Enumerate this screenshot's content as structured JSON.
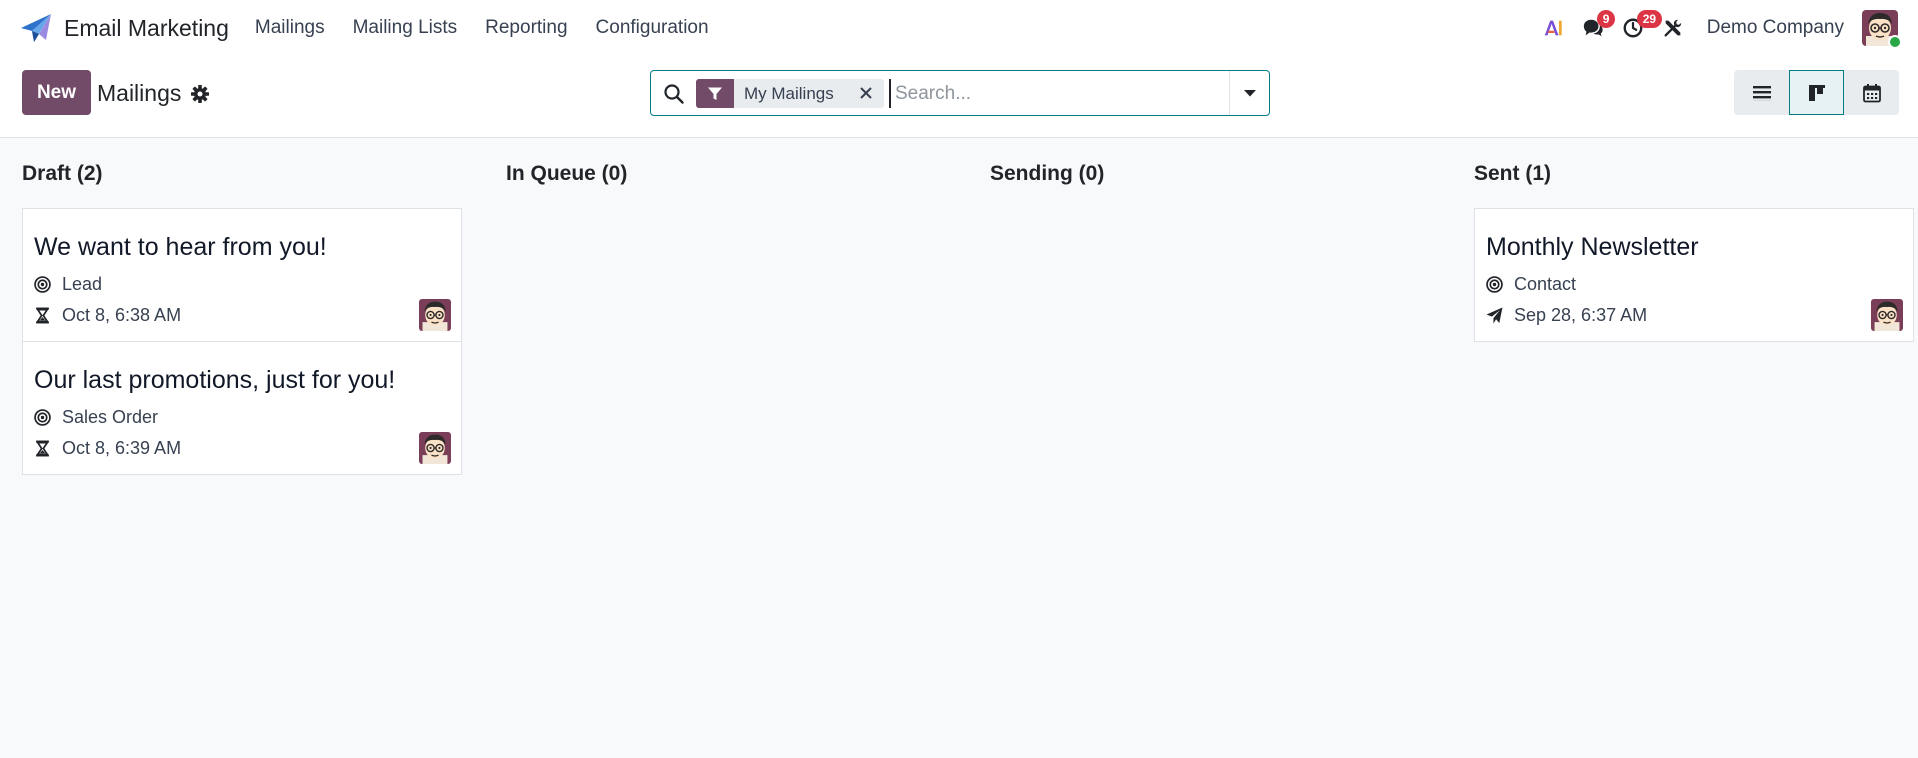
{
  "app": {
    "name": "Email Marketing",
    "brand_icon": "paper-plane-logo"
  },
  "menu": [
    {
      "label": "Mailings"
    },
    {
      "label": "Mailing Lists"
    },
    {
      "label": "Reporting"
    },
    {
      "label": "Configuration"
    }
  ],
  "systray": {
    "ai_icon": "ai-icon",
    "messages": {
      "icon": "chat-icon",
      "count": "9"
    },
    "activities": {
      "icon": "clock-icon",
      "count": "29"
    },
    "debug_icon": "tools-icon",
    "company": "Demo Company",
    "user_status": "online"
  },
  "control_panel": {
    "new_label": "New",
    "title": "Mailings",
    "search": {
      "facet_label": "My Mailings",
      "placeholder": "Search..."
    },
    "views": [
      "list",
      "kanban",
      "calendar"
    ],
    "active_view": "kanban"
  },
  "colors": {
    "primary": "#714b67",
    "accent": "#017e84",
    "badge": "#dc3545"
  },
  "columns": [
    {
      "title": "Draft (2)",
      "cards": [
        {
          "title": "We want to hear from you!",
          "target": "Lead",
          "date_icon": "hourglass-icon",
          "date": "Oct 8, 6:38 AM"
        },
        {
          "title": "Our last promotions, just for you!",
          "target": "Sales Order",
          "date_icon": "hourglass-icon",
          "date": "Oct 8, 6:39 AM"
        }
      ]
    },
    {
      "title": "In Queue (0)",
      "cards": []
    },
    {
      "title": "Sending (0)",
      "cards": []
    },
    {
      "title": "Sent (1)",
      "cards": [
        {
          "title": "Monthly Newsletter",
          "target": "Contact",
          "date_icon": "paper-plane-icon",
          "date": "Sep 28, 6:37 AM"
        }
      ]
    }
  ]
}
